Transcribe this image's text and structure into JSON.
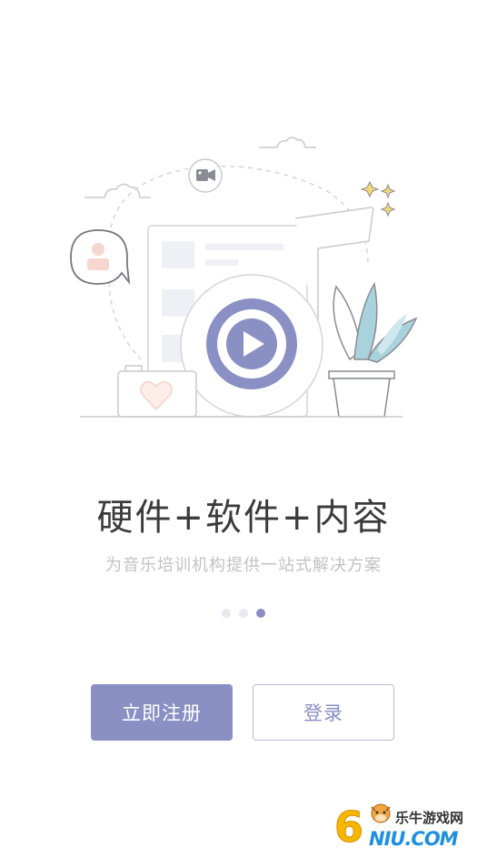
{
  "slide": {
    "title": "硬件+软件+内容",
    "subtitle": "为音乐培训机构提供一站式解决方案",
    "page_indicator": {
      "total": 3,
      "active_index": 2
    }
  },
  "actions": {
    "register_label": "立即注册",
    "login_label": "登录"
  },
  "watermark": {
    "brand_digit": "6",
    "brand_cn": "乐牛游戏网",
    "brand_en": "NIU.COM"
  },
  "colors": {
    "accent": "#8a8fc4",
    "title": "#3b3b3b",
    "subtitle": "#c2c2c2",
    "dot_inactive": "#e8e8ee",
    "plant": "#a9d3dc",
    "heart": "#f6d7cf"
  },
  "icons": [
    "video-camera-icon",
    "user-avatar-icon",
    "play-icon",
    "heart-icon",
    "sparkle-icon",
    "cloud-icon"
  ]
}
